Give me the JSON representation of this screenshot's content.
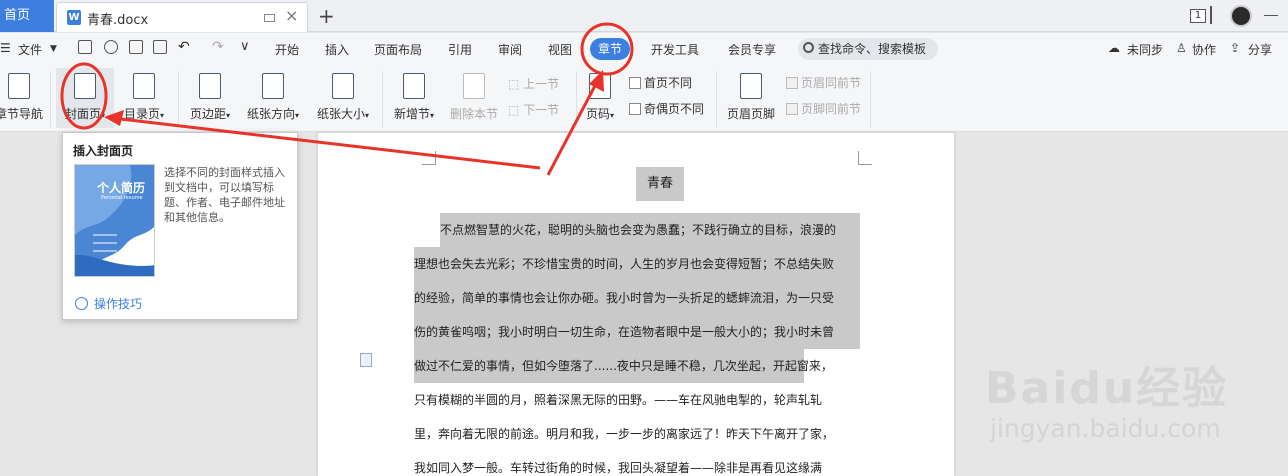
{
  "titlebar": {
    "home_tab": "首页",
    "doc_tab": "青春.docx",
    "doc_icon": "W",
    "page_indicator": "1"
  },
  "menubar": {
    "file": "文件",
    "items": [
      "开始",
      "插入",
      "页面布局",
      "引用",
      "审阅",
      "视图",
      "章节",
      "开发工具",
      "会员专享"
    ],
    "active": "章节",
    "search_placeholder": "查找命令、搜索模板",
    "right": [
      "未同步",
      "协作",
      "分享"
    ]
  },
  "ribbon": {
    "nav": "章节导航",
    "cover": "封面页",
    "toc": "目录页",
    "margin": "页边距",
    "orientation": "纸张方向",
    "size": "纸张大小",
    "new_section": "新增节",
    "delete_section": "删除本节",
    "prev_section": "上一节",
    "next_section": "下一节",
    "page_number": "页码",
    "first_page_diff": "首页不同",
    "odd_even_diff": "奇偶页不同",
    "header_footer": "页眉页脚",
    "header_same": "页眉同前节",
    "footer_same": "页脚同前节"
  },
  "popup": {
    "title": "插入封面页",
    "description": "选择不同的封面样式插入到文档中，可以填写标题、作者、电子邮件地址和其他信息。",
    "thumb_title": "个人简历",
    "thumb_sub": "Personal resume",
    "tip": "操作技巧"
  },
  "document": {
    "title": "青春",
    "lines": [
      "不点燃智慧的火花，聪明的头脑也会变为愚蠢；不践行确立的目标，浪漫的",
      "理想也会失去光彩；不珍惜宝贵的时间，人生的岁月也会变得短暂；不总结失败",
      "的经验，简单的事情也会让你办砸。我小时曾为一头折足的蟋蟀流泪，为一只受",
      "伤的黄雀呜咽；我小时明白一切生命，在造物者眼中是一般大小的；我小时未曾",
      "做过不仁爱的事情，但如今堕落了......夜中只是睡不稳，几次坐起，开起窗来，",
      "只有模糊的半圆的月，照着深黑无际的田野。——车在风驰电掣的，轮声轧轧",
      "里，奔向着无限的前途。明月和我，一步一步的离家远了！昨天下午离开了家，",
      "我如同入梦一般。车转过街角的时候，我回头凝望着——除非是再看见这缘满"
    ]
  },
  "watermark": {
    "brand": "Baidu经验",
    "url": "jingyan.baidu.com"
  },
  "colors": {
    "accent": "#3c7fe1",
    "highlight": "#c9c9c9",
    "annotation": "#e8332a"
  }
}
